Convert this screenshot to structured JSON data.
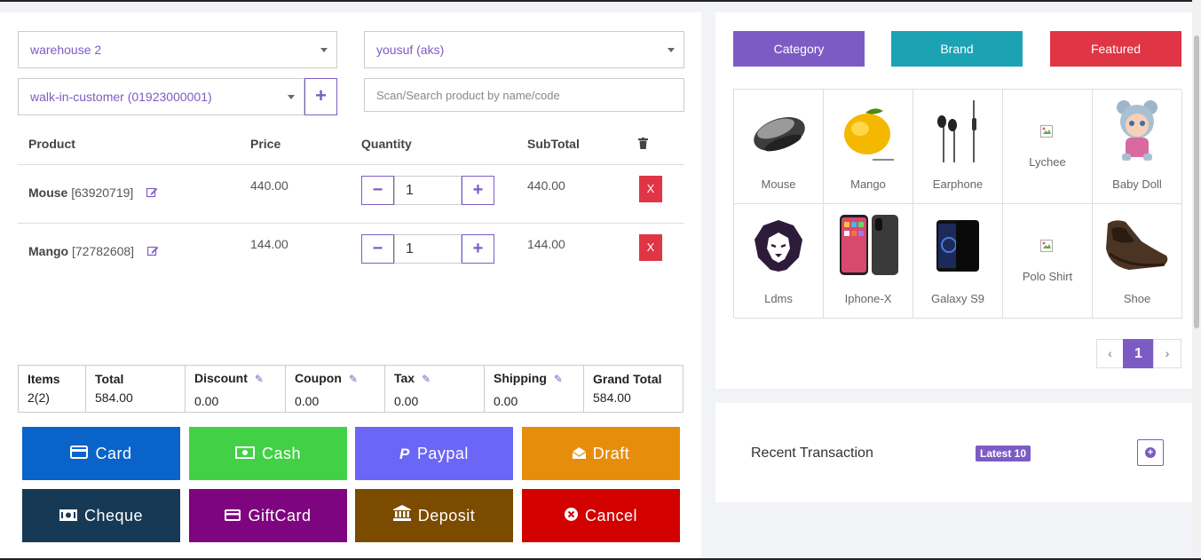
{
  "selectors": {
    "warehouse": "warehouse 2",
    "biller": "yousuf (aks)",
    "customer": "walk-in-customer (01923000001)",
    "search_placeholder": "Scan/Search product by name/code"
  },
  "table": {
    "headers": [
      "Product",
      "Price",
      "Quantity",
      "SubTotal"
    ],
    "rows": [
      {
        "name": "Mouse",
        "code": "[63920719]",
        "price": "440.00",
        "qty": "1",
        "subtotal": "440.00",
        "delete": "X"
      },
      {
        "name": "Mango",
        "code": "[72782608]",
        "price": "144.00",
        "qty": "1",
        "subtotal": "144.00",
        "delete": "X"
      }
    ]
  },
  "summary": {
    "items_label": "Items",
    "items_value": "2(2)",
    "total_label": "Total",
    "total_value": "584.00",
    "discount_label": "Discount",
    "discount_value": "0.00",
    "coupon_label": "Coupon",
    "coupon_value": "0.00",
    "tax_label": "Tax",
    "tax_value": "0.00",
    "shipping_label": "Shipping",
    "shipping_value": "0.00",
    "grand_total_label": "Grand Total",
    "grand_total_value": "584.00"
  },
  "payments": {
    "card": "Card",
    "cash": "Cash",
    "paypal": "Paypal",
    "draft": "Draft",
    "cheque": "Cheque",
    "giftcard": "GiftCard",
    "deposit": "Deposit",
    "cancel": "Cancel"
  },
  "filters": {
    "category": "Category",
    "brand": "Brand",
    "featured": "Featured"
  },
  "products": [
    "Mouse",
    "Mango",
    "Earphone",
    "Lychee",
    "Baby Doll",
    "Ldms",
    "Iphone-X",
    "Galaxy S9",
    "Polo Shirt",
    "Shoe"
  ],
  "pagination": {
    "current": "1",
    "prev": "‹",
    "next": "›"
  },
  "recent": {
    "title": "Recent Transaction",
    "badge": "Latest 10"
  },
  "colors": {
    "accent": "#7c5cc4",
    "card": "#0a63c9",
    "cash": "#42d146",
    "paypal": "#6b66f5",
    "draft": "#e68e0c",
    "cheque": "#163a56",
    "giftcard": "#7f047f",
    "deposit": "#7b4b00",
    "cancel": "#d30000",
    "category": "#7c5cc4",
    "brand": "#1ba3b4",
    "featured": "#e03545"
  }
}
